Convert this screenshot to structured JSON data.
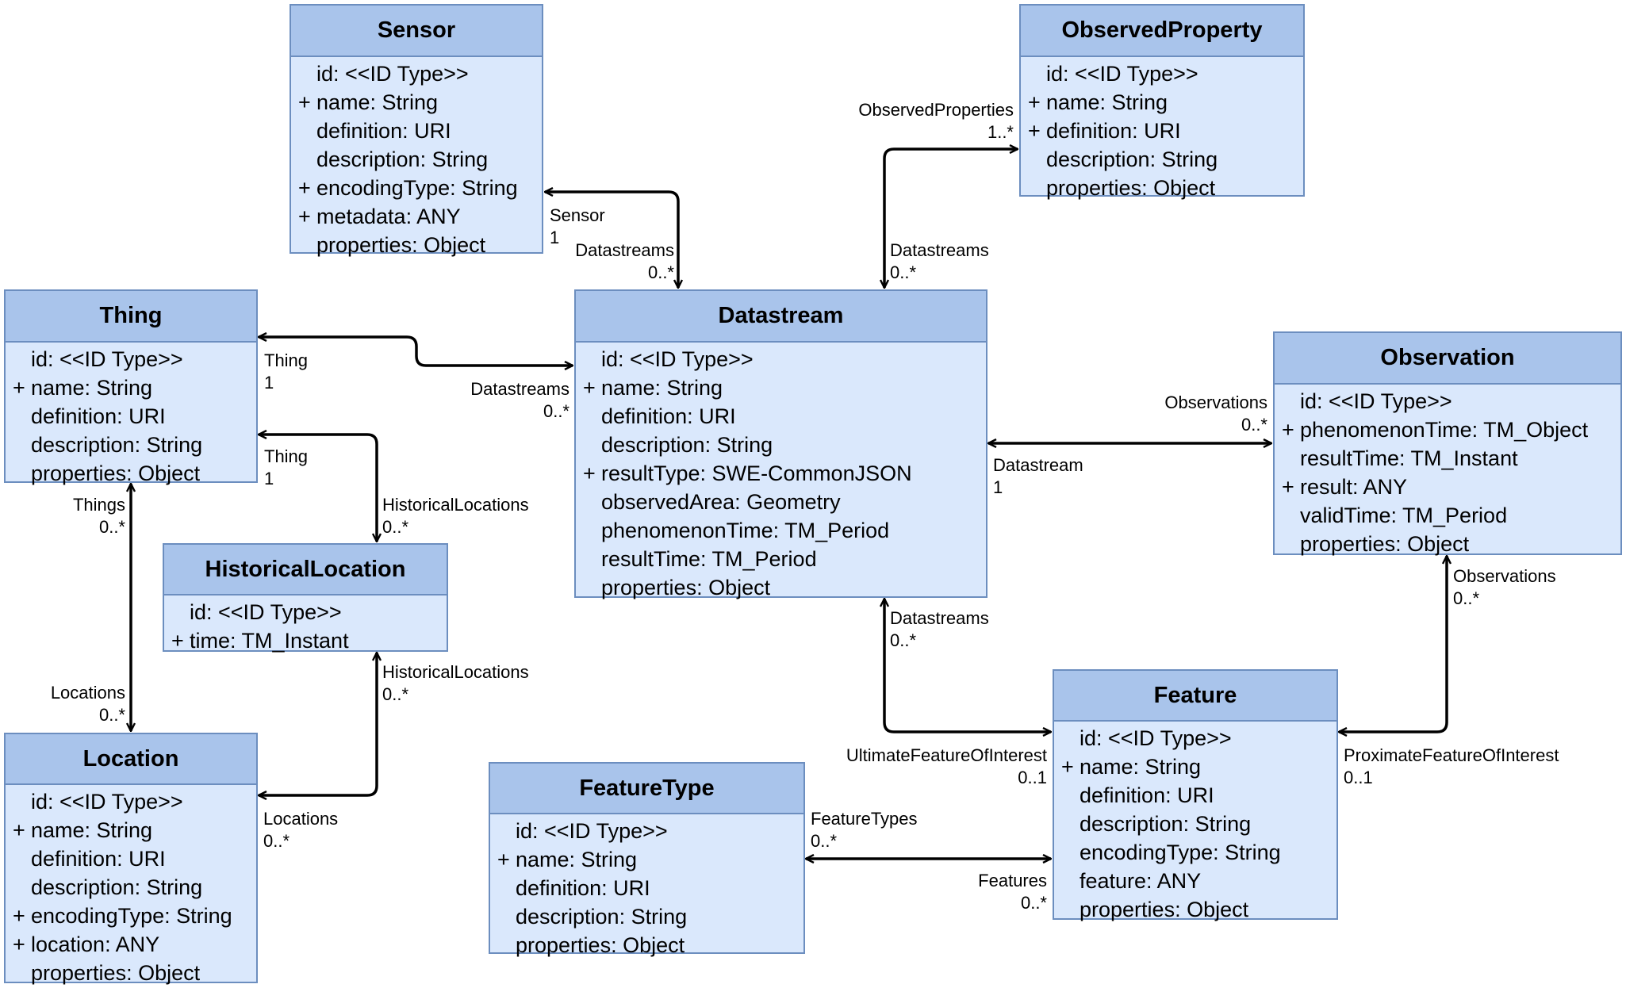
{
  "diagram": {
    "type": "UML class diagram",
    "colors": {
      "header": "#a9c4eb",
      "body": "#dae8fc",
      "border": "#6c8ebf",
      "line": "#000000"
    }
  },
  "classes": {
    "sensor": {
      "name": "Sensor",
      "attributes": [
        {
          "vis": "",
          "text": "id: <<ID Type>>"
        },
        {
          "vis": "+",
          "text": "name: String"
        },
        {
          "vis": "",
          "text": "definition: URI"
        },
        {
          "vis": "",
          "text": "description: String"
        },
        {
          "vis": "+",
          "text": "encodingType: String"
        },
        {
          "vis": "+",
          "text": "metadata: ANY"
        },
        {
          "vis": "",
          "text": "properties: Object"
        }
      ]
    },
    "observedProperty": {
      "name": "ObservedProperty",
      "attributes": [
        {
          "vis": "",
          "text": "id: <<ID Type>>"
        },
        {
          "vis": "+",
          "text": "name: String"
        },
        {
          "vis": "+",
          "text": "definition: URI"
        },
        {
          "vis": "",
          "text": "description: String"
        },
        {
          "vis": "",
          "text": "properties: Object"
        }
      ]
    },
    "thing": {
      "name": "Thing",
      "attributes": [
        {
          "vis": "",
          "text": "id: <<ID Type>>"
        },
        {
          "vis": "+",
          "text": "name: String"
        },
        {
          "vis": "",
          "text": "definition: URI"
        },
        {
          "vis": "",
          "text": "description: String"
        },
        {
          "vis": "",
          "text": "properties: Object"
        }
      ]
    },
    "datastream": {
      "name": "Datastream",
      "attributes": [
        {
          "vis": "",
          "text": "id: <<ID Type>>"
        },
        {
          "vis": "+",
          "text": "name: String"
        },
        {
          "vis": "",
          "text": "definition: URI"
        },
        {
          "vis": "",
          "text": "description: String"
        },
        {
          "vis": "+",
          "text": "resultType: SWE-CommonJSON"
        },
        {
          "vis": "",
          "text": "observedArea: Geometry"
        },
        {
          "vis": "",
          "text": "phenomenonTime: TM_Period"
        },
        {
          "vis": "",
          "text": "resultTime: TM_Period"
        },
        {
          "vis": "",
          "text": "properties: Object"
        }
      ]
    },
    "observation": {
      "name": "Observation",
      "attributes": [
        {
          "vis": "",
          "text": "id: <<ID Type>>"
        },
        {
          "vis": "+",
          "text": "phenomenonTime: TM_Object"
        },
        {
          "vis": "",
          "text": "resultTime: TM_Instant"
        },
        {
          "vis": "+",
          "text": "result: ANY"
        },
        {
          "vis": "",
          "text": "validTime: TM_Period"
        },
        {
          "vis": "",
          "text": "properties: Object"
        }
      ]
    },
    "historicalLocation": {
      "name": "HistoricalLocation",
      "attributes": [
        {
          "vis": "",
          "text": "id: <<ID Type>>"
        },
        {
          "vis": "+",
          "text": "time: TM_Instant"
        }
      ]
    },
    "location": {
      "name": "Location",
      "attributes": [
        {
          "vis": "",
          "text": "id: <<ID Type>>"
        },
        {
          "vis": "+",
          "text": "name: String"
        },
        {
          "vis": "",
          "text": "definition: URI"
        },
        {
          "vis": "",
          "text": "description: String"
        },
        {
          "vis": "+",
          "text": "encodingType: String"
        },
        {
          "vis": "+",
          "text": "location: ANY"
        },
        {
          "vis": "",
          "text": "properties: Object"
        }
      ]
    },
    "featureType": {
      "name": "FeatureType",
      "attributes": [
        {
          "vis": "",
          "text": "id: <<ID Type>>"
        },
        {
          "vis": "+",
          "text": "name: String"
        },
        {
          "vis": "",
          "text": "definition: URI"
        },
        {
          "vis": "",
          "text": "description: String"
        },
        {
          "vis": "",
          "text": "properties: Object"
        }
      ]
    },
    "feature": {
      "name": "Feature",
      "attributes": [
        {
          "vis": "",
          "text": "id: <<ID Type>>"
        },
        {
          "vis": "+",
          "text": "name: String"
        },
        {
          "vis": "",
          "text": "definition: URI"
        },
        {
          "vis": "",
          "text": "description: String"
        },
        {
          "vis": "",
          "text": "encodingType: String"
        },
        {
          "vis": "",
          "text": "feature: ANY"
        },
        {
          "vis": "",
          "text": "properties: Object"
        }
      ]
    }
  },
  "associations": [
    {
      "id": "sensor-datastream",
      "a": {
        "role": "Sensor",
        "mult": "1"
      },
      "b": {
        "role": "Datastreams",
        "mult": "0..*"
      }
    },
    {
      "id": "observedproperty-datastream",
      "a": {
        "role": "ObservedProperties",
        "mult": "1..*"
      },
      "b": {
        "role": "Datastreams",
        "mult": "0..*"
      }
    },
    {
      "id": "thing-datastream",
      "a": {
        "role": "Thing",
        "mult": "1"
      },
      "b": {
        "role": "Datastreams",
        "mult": "0..*"
      }
    },
    {
      "id": "thing-historicallocation",
      "a": {
        "role": "Thing",
        "mult": "1"
      },
      "b": {
        "role": "HistoricalLocations",
        "mult": "0..*"
      }
    },
    {
      "id": "thing-location",
      "a": {
        "role": "Things",
        "mult": "0..*"
      },
      "b": {
        "role": "Locations",
        "mult": "0..*"
      }
    },
    {
      "id": "historicallocation-location",
      "a": {
        "role": "HistoricalLocations",
        "mult": "0..*"
      },
      "b": {
        "role": "Locations",
        "mult": "0..*"
      }
    },
    {
      "id": "datastream-observation",
      "a": {
        "role": "Observations",
        "mult": "0..*"
      },
      "b": {
        "role": "Datastream",
        "mult": "1"
      }
    },
    {
      "id": "datastream-feature",
      "a": {
        "role": "Datastreams",
        "mult": "0..*"
      },
      "b": {
        "role": "UltimateFeatureOfInterest",
        "mult": "0..1"
      }
    },
    {
      "id": "observation-feature",
      "a": {
        "role": "Observations",
        "mult": "0..*"
      },
      "b": {
        "role": "ProximateFeatureOfInterest",
        "mult": "0..1"
      }
    },
    {
      "id": "featuretype-feature",
      "a": {
        "role": "FeatureTypes",
        "mult": "0..*"
      },
      "b": {
        "role": "Features",
        "mult": "0..*"
      }
    }
  ]
}
